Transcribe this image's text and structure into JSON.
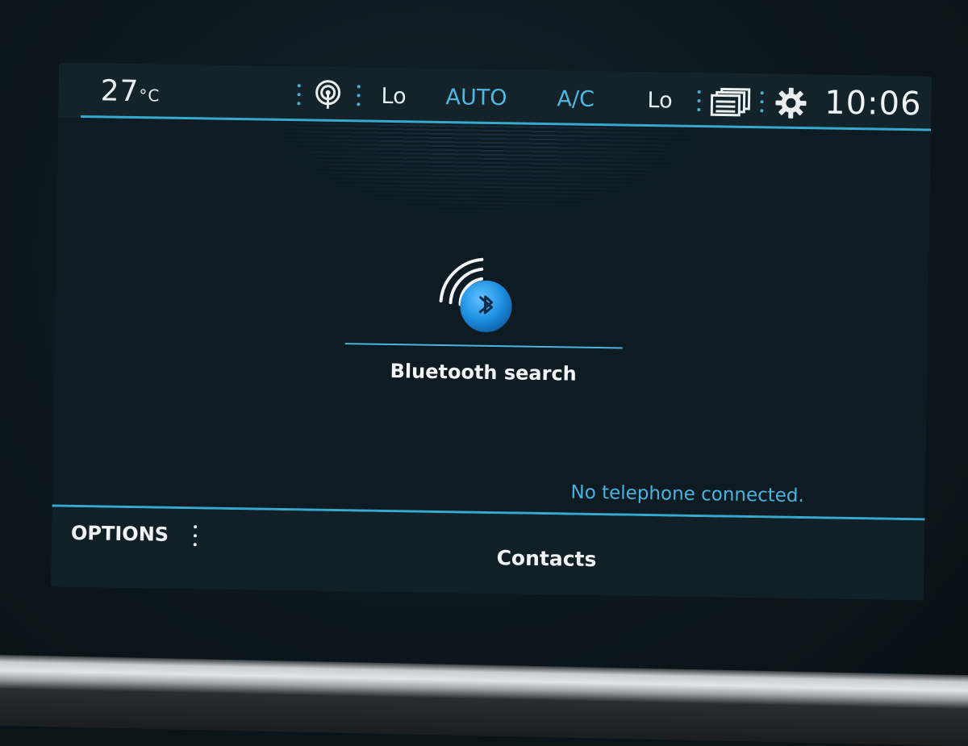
{
  "status_bar": {
    "temperature": "27",
    "temperature_unit": "°C",
    "fan_left": "Lo",
    "mode": "AUTO",
    "ac": "A/C",
    "fan_right": "Lo",
    "clock": "10:06"
  },
  "main": {
    "bluetooth_label": "Bluetooth search",
    "status_message": "No telephone connected."
  },
  "bottom_bar": {
    "options_label": "OPTIONS",
    "contacts_label": "Contacts"
  },
  "colors": {
    "accent": "#36a9d0",
    "status_blue": "#49b3de",
    "bluetooth_blue": "#1e8fe0",
    "text": "#f0f4f6",
    "screen_bg": "#0e1b22"
  },
  "icons": {
    "radio": "broadcast-icon",
    "pages": "stacked-pages-icon",
    "settings": "gear-icon",
    "bluetooth": "bluetooth-icon",
    "signal": "signal-arcs-icon"
  }
}
